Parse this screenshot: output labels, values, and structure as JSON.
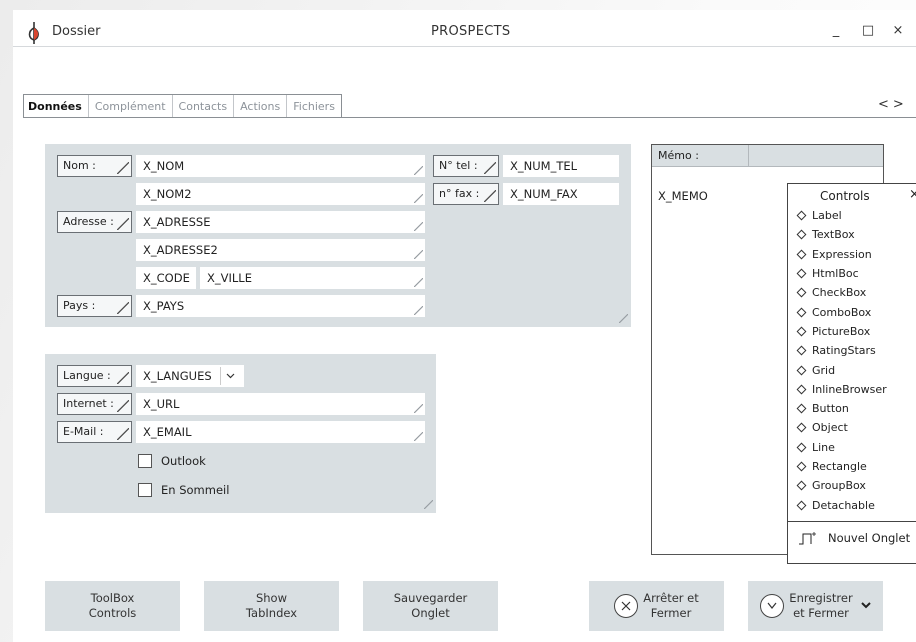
{
  "window": {
    "app_name": "Dossier",
    "title": "PROSPECTS",
    "minimize_glyph": "_",
    "maximize_glyph": "□",
    "close_glyph": "×"
  },
  "tabs": [
    {
      "label": "Données",
      "active": true
    },
    {
      "label": "Complément",
      "active": false
    },
    {
      "label": "Contacts",
      "active": false
    },
    {
      "label": "Actions",
      "active": false
    },
    {
      "label": "Fichiers",
      "active": false
    }
  ],
  "tab_nav": {
    "prev": "<",
    "next": ">"
  },
  "address_panel": {
    "nom_label": "Nom :",
    "nom_value": "X_NOM",
    "nom2_value": "X_NOM2",
    "adresse_label": "Adresse :",
    "adresse_value": "X_ADRESSE",
    "adresse2_value": "X_ADRESSE2",
    "code_value": "X_CODE",
    "ville_value": "X_VILLE",
    "pays_label": "Pays :",
    "pays_value": "X_PAYS",
    "tel_label": "N° tel :",
    "tel_value": "X_NUM_TEL",
    "fax_label": "n° fax :",
    "fax_value": "X_NUM_FAX"
  },
  "contact_panel": {
    "langue_label": "Langue :",
    "langue_value": "X_LANGUES",
    "internet_label": "Internet :",
    "internet_value": "X_URL",
    "email_label": "E-Mail :",
    "email_value": "X_EMAIL",
    "outlook_label": "Outlook",
    "outlook_checked": false,
    "sommeil_label": "En Sommeil",
    "sommeil_checked": false
  },
  "memo": {
    "label": "Mémo :",
    "value": "X_MEMO"
  },
  "controls_popup": {
    "title": "Controls",
    "close_glyph": "×",
    "items": [
      "Label",
      "TextBox",
      "Expression",
      "HtmlBoc",
      "CheckBox",
      "ComboBox",
      "PictureBox",
      "RatingStars",
      "Grid",
      "InlineBrowser",
      "Button",
      "Object",
      "Line",
      "Rectangle",
      "GroupBox",
      "Detachable"
    ],
    "new_tab_label": "Nouvel Onglet"
  },
  "buttons": {
    "toolbox_line1": "ToolBox",
    "toolbox_line2": "Controls",
    "show_line1": "Show",
    "show_line2": "TabIndex",
    "save_tab_line1": "Sauvegarder",
    "save_tab_line2": "Onglet",
    "stop_line1": "Arrêter et",
    "stop_line2": "Fermer",
    "save_close_line1": "Enregistrer",
    "save_close_line2": "et Fermer"
  },
  "colors": {
    "panel": "#d9dfe2",
    "accent_logo": "#d9462f",
    "text": "#2a2a2a"
  }
}
